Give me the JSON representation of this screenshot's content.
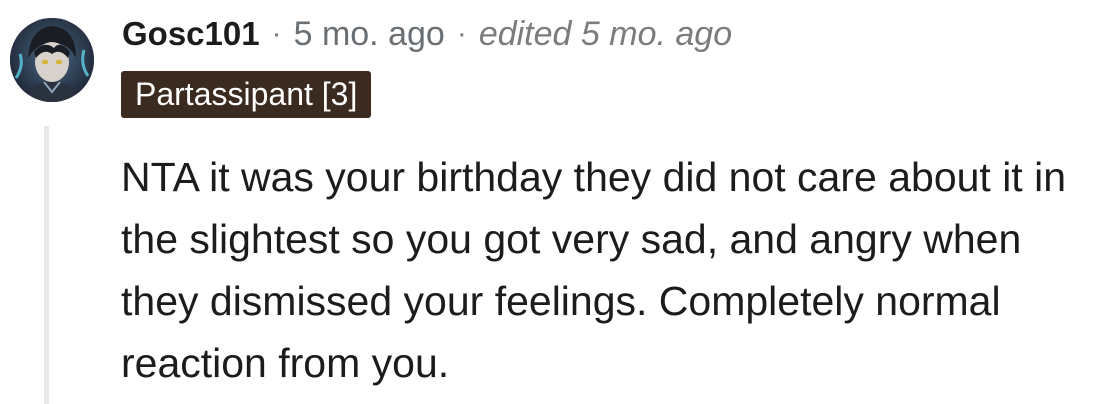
{
  "comment": {
    "author": "Gosc101",
    "separator": "·",
    "posted_ago": "5 mo. ago",
    "edited_label": "edited 5 mo. ago",
    "flair": "Partassipant [3]",
    "body": "NTA it was your birthday they did not care about it in the slightest so you got very sad, and angry when they dismissed your feelings. Completely normal reaction from you."
  },
  "colors": {
    "flair_background": "#3b2a20",
    "flair_text": "#ffffff",
    "username": "#1c1c1c",
    "meta_text": "#7c7c7c",
    "thread_line": "#e6e8ea"
  },
  "icons": {
    "avatar": "user-avatar-anime-character"
  }
}
